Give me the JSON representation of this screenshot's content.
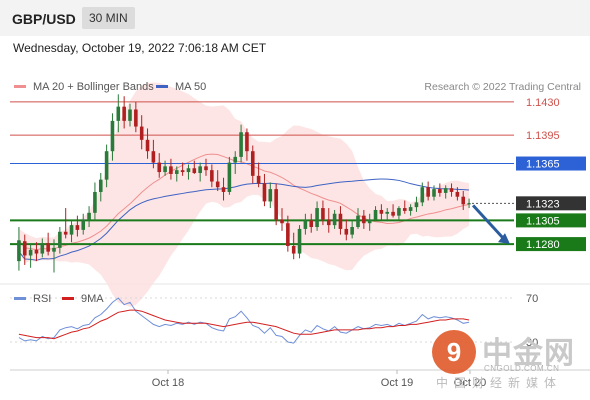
{
  "header": {
    "pair": "GBP/USD",
    "timeframe": "30 MIN"
  },
  "datetime": "Wednesday, October 19, 2022 7:06:18 AM CET",
  "colors": {
    "bollinger": "#f08f8f",
    "ma50": "#3e63c3",
    "rsi": "#6f8fd8",
    "rsi_ma": "#d22020",
    "up": "#2a7a3a",
    "down": "#b02020",
    "support": "#1a7a1a",
    "resistance": "#d0514b",
    "pivot": "#2d62d6"
  },
  "chart_data": {
    "type": "candlestick",
    "legend": [
      {
        "label": "MA 20 + Bollinger Bands",
        "color": "#f08f8f"
      },
      {
        "label": "MA 50",
        "color": "#3e63c3"
      }
    ],
    "credit": "Research © 2022 Trading Central",
    "x_ticks": [
      "Oct 18",
      "Oct 19",
      "Oct 20"
    ],
    "y_range": [
      1.124,
      1.147
    ],
    "levels": [
      {
        "label": "1.1430",
        "value": 1.143,
        "kind": "resistance"
      },
      {
        "label": "1.1395",
        "value": 1.1395,
        "kind": "resistance"
      },
      {
        "label": "1.1365",
        "value": 1.1365,
        "kind": "pivot"
      },
      {
        "label": "1.1323",
        "value": 1.1323,
        "kind": "last"
      },
      {
        "label": "1.1305",
        "value": 1.1305,
        "kind": "support"
      },
      {
        "label": "1.1280",
        "value": 1.128,
        "kind": "support"
      }
    ],
    "candles": [
      {
        "o": 1.1262,
        "h": 1.1298,
        "l": 1.1252,
        "c": 1.1284
      },
      {
        "o": 1.1283,
        "h": 1.129,
        "l": 1.1258,
        "c": 1.1268
      },
      {
        "o": 1.1268,
        "h": 1.128,
        "l": 1.1255,
        "c": 1.1274
      },
      {
        "o": 1.1274,
        "h": 1.1282,
        "l": 1.1262,
        "c": 1.127
      },
      {
        "o": 1.127,
        "h": 1.1286,
        "l": 1.1266,
        "c": 1.1281
      },
      {
        "o": 1.1281,
        "h": 1.1292,
        "l": 1.1268,
        "c": 1.1272
      },
      {
        "o": 1.1272,
        "h": 1.1285,
        "l": 1.125,
        "c": 1.1276
      },
      {
        "o": 1.1276,
        "h": 1.1298,
        "l": 1.127,
        "c": 1.1293
      },
      {
        "o": 1.1293,
        "h": 1.1318,
        "l": 1.1286,
        "c": 1.129
      },
      {
        "o": 1.129,
        "h": 1.1305,
        "l": 1.1282,
        "c": 1.13
      },
      {
        "o": 1.13,
        "h": 1.131,
        "l": 1.1288,
        "c": 1.1295
      },
      {
        "o": 1.1295,
        "h": 1.1312,
        "l": 1.129,
        "c": 1.1306
      },
      {
        "o": 1.1306,
        "h": 1.132,
        "l": 1.1298,
        "c": 1.1313
      },
      {
        "o": 1.1313,
        "h": 1.1345,
        "l": 1.1305,
        "c": 1.1335
      },
      {
        "o": 1.1335,
        "h": 1.1355,
        "l": 1.1325,
        "c": 1.1348
      },
      {
        "o": 1.1348,
        "h": 1.1385,
        "l": 1.134,
        "c": 1.1378
      },
      {
        "o": 1.1378,
        "h": 1.1418,
        "l": 1.1368,
        "c": 1.141
      },
      {
        "o": 1.141,
        "h": 1.1438,
        "l": 1.1398,
        "c": 1.1425
      },
      {
        "o": 1.1425,
        "h": 1.1436,
        "l": 1.1402,
        "c": 1.141
      },
      {
        "o": 1.141,
        "h": 1.1428,
        "l": 1.1404,
        "c": 1.1422
      },
      {
        "o": 1.1422,
        "h": 1.143,
        "l": 1.1398,
        "c": 1.1404
      },
      {
        "o": 1.1404,
        "h": 1.1416,
        "l": 1.138,
        "c": 1.139
      },
      {
        "o": 1.139,
        "h": 1.1402,
        "l": 1.137,
        "c": 1.1378
      },
      {
        "o": 1.1378,
        "h": 1.139,
        "l": 1.136,
        "c": 1.1366
      },
      {
        "o": 1.1366,
        "h": 1.1376,
        "l": 1.135,
        "c": 1.1356
      },
      {
        "o": 1.1356,
        "h": 1.1368,
        "l": 1.1352,
        "c": 1.1362
      },
      {
        "o": 1.1362,
        "h": 1.137,
        "l": 1.1348,
        "c": 1.1354
      },
      {
        "o": 1.1354,
        "h": 1.1362,
        "l": 1.1346,
        "c": 1.1358
      },
      {
        "o": 1.1358,
        "h": 1.1366,
        "l": 1.1352,
        "c": 1.1356
      },
      {
        "o": 1.1356,
        "h": 1.1364,
        "l": 1.1348,
        "c": 1.136
      },
      {
        "o": 1.136,
        "h": 1.1368,
        "l": 1.1354,
        "c": 1.1355
      },
      {
        "o": 1.1355,
        "h": 1.1366,
        "l": 1.1346,
        "c": 1.1362
      },
      {
        "o": 1.1362,
        "h": 1.137,
        "l": 1.1352,
        "c": 1.1358
      },
      {
        "o": 1.1358,
        "h": 1.1364,
        "l": 1.134,
        "c": 1.1346
      },
      {
        "o": 1.1346,
        "h": 1.1358,
        "l": 1.1336,
        "c": 1.134
      },
      {
        "o": 1.134,
        "h": 1.135,
        "l": 1.1326,
        "c": 1.1335
      },
      {
        "o": 1.1335,
        "h": 1.1372,
        "l": 1.1332,
        "c": 1.1366
      },
      {
        "o": 1.1366,
        "h": 1.1378,
        "l": 1.1354,
        "c": 1.1372
      },
      {
        "o": 1.1372,
        "h": 1.1406,
        "l": 1.1366,
        "c": 1.1398
      },
      {
        "o": 1.1398,
        "h": 1.1402,
        "l": 1.1368,
        "c": 1.1378
      },
      {
        "o": 1.1378,
        "h": 1.1384,
        "l": 1.1344,
        "c": 1.1352
      },
      {
        "o": 1.1352,
        "h": 1.1366,
        "l": 1.134,
        "c": 1.1344
      },
      {
        "o": 1.1344,
        "h": 1.1354,
        "l": 1.132,
        "c": 1.1325
      },
      {
        "o": 1.1325,
        "h": 1.1345,
        "l": 1.1318,
        "c": 1.1338
      },
      {
        "o": 1.1338,
        "h": 1.1344,
        "l": 1.13,
        "c": 1.1306
      },
      {
        "o": 1.1306,
        "h": 1.1318,
        "l": 1.1294,
        "c": 1.1302
      },
      {
        "o": 1.1302,
        "h": 1.131,
        "l": 1.1272,
        "c": 1.1278
      },
      {
        "o": 1.1278,
        "h": 1.1292,
        "l": 1.1264,
        "c": 1.127
      },
      {
        "o": 1.127,
        "h": 1.13,
        "l": 1.1265,
        "c": 1.1296
      },
      {
        "o": 1.1296,
        "h": 1.1312,
        "l": 1.129,
        "c": 1.1305
      },
      {
        "o": 1.1305,
        "h": 1.1312,
        "l": 1.1292,
        "c": 1.1298
      },
      {
        "o": 1.1298,
        "h": 1.1325,
        "l": 1.1294,
        "c": 1.1318
      },
      {
        "o": 1.1318,
        "h": 1.1326,
        "l": 1.13,
        "c": 1.1306
      },
      {
        "o": 1.1306,
        "h": 1.1318,
        "l": 1.1292,
        "c": 1.13
      },
      {
        "o": 1.13,
        "h": 1.1316,
        "l": 1.1296,
        "c": 1.1312
      },
      {
        "o": 1.1312,
        "h": 1.132,
        "l": 1.129,
        "c": 1.1296
      },
      {
        "o": 1.1296,
        "h": 1.1306,
        "l": 1.1284,
        "c": 1.129
      },
      {
        "o": 1.129,
        "h": 1.1304,
        "l": 1.1286,
        "c": 1.1298
      },
      {
        "o": 1.1298,
        "h": 1.1318,
        "l": 1.1296,
        "c": 1.131
      },
      {
        "o": 1.131,
        "h": 1.1316,
        "l": 1.1296,
        "c": 1.1302
      },
      {
        "o": 1.1302,
        "h": 1.1312,
        "l": 1.1294,
        "c": 1.1306
      },
      {
        "o": 1.1306,
        "h": 1.132,
        "l": 1.1304,
        "c": 1.1316
      },
      {
        "o": 1.1316,
        "h": 1.1322,
        "l": 1.1306,
        "c": 1.1312
      },
      {
        "o": 1.1312,
        "h": 1.1318,
        "l": 1.1304,
        "c": 1.1314
      },
      {
        "o": 1.1314,
        "h": 1.1322,
        "l": 1.1308,
        "c": 1.131
      },
      {
        "o": 1.131,
        "h": 1.132,
        "l": 1.1306,
        "c": 1.1318
      },
      {
        "o": 1.1318,
        "h": 1.1326,
        "l": 1.1312,
        "c": 1.1315
      },
      {
        "o": 1.1315,
        "h": 1.1322,
        "l": 1.131,
        "c": 1.1319
      },
      {
        "o": 1.1319,
        "h": 1.133,
        "l": 1.1314,
        "c": 1.1324
      },
      {
        "o": 1.1324,
        "h": 1.1345,
        "l": 1.132,
        "c": 1.134
      },
      {
        "o": 1.134,
        "h": 1.1346,
        "l": 1.1326,
        "c": 1.133
      },
      {
        "o": 1.133,
        "h": 1.1342,
        "l": 1.1326,
        "c": 1.1338
      },
      {
        "o": 1.1338,
        "h": 1.1344,
        "l": 1.133,
        "c": 1.1334
      },
      {
        "o": 1.1334,
        "h": 1.1342,
        "l": 1.1328,
        "c": 1.1339
      },
      {
        "o": 1.1339,
        "h": 1.1344,
        "l": 1.133,
        "c": 1.1335
      },
      {
        "o": 1.1335,
        "h": 1.134,
        "l": 1.1326,
        "c": 1.133
      },
      {
        "o": 1.133,
        "h": 1.1336,
        "l": 1.1316,
        "c": 1.1322
      },
      {
        "o": 1.1322,
        "h": 1.1328,
        "l": 1.1318,
        "c": 1.1323
      }
    ],
    "rsi": {
      "label": "RSI",
      "ma_label": "9MA",
      "levels": [
        70,
        30
      ],
      "values": [
        34,
        31,
        32,
        31,
        35,
        33,
        34,
        41,
        43,
        44,
        42,
        45,
        46,
        52,
        55,
        60,
        66,
        70,
        64,
        66,
        58,
        54,
        50,
        46,
        44,
        46,
        45,
        47,
        46,
        48,
        46,
        48,
        47,
        43,
        41,
        40,
        51,
        53,
        58,
        52,
        45,
        43,
        38,
        43,
        36,
        35,
        30,
        29,
        36,
        41,
        39,
        45,
        42,
        40,
        44,
        39,
        38,
        41,
        44,
        42,
        43,
        46,
        45,
        46,
        44,
        47,
        45,
        47,
        49,
        55,
        51,
        53,
        52,
        53,
        52,
        50,
        47,
        48
      ],
      "ma_values": [
        37,
        36,
        35,
        34,
        34,
        34,
        33,
        35,
        37,
        39,
        40,
        42,
        43,
        46,
        49,
        51,
        54,
        57,
        58,
        59,
        59,
        58,
        56,
        54,
        52,
        50,
        49,
        48,
        47,
        47,
        47,
        47,
        47,
        46,
        45,
        44,
        45,
        46,
        47,
        48,
        48,
        47,
        46,
        45,
        44,
        42,
        40,
        38,
        37,
        37,
        37,
        38,
        39,
        40,
        41,
        41,
        41,
        41,
        41,
        42,
        42,
        43,
        43,
        44,
        44,
        45,
        45,
        46,
        46,
        47,
        48,
        49,
        50,
        50,
        51,
        51,
        51,
        50
      ]
    }
  }
}
